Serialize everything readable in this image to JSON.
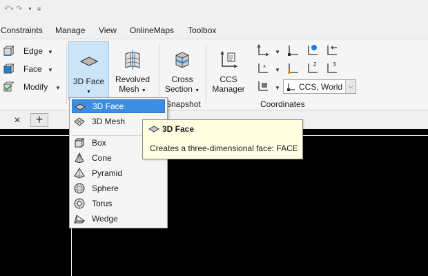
{
  "menu": [
    "Constraints",
    "Manage",
    "View",
    "OnlineMaps",
    "Toolbox"
  ],
  "ribbon": {
    "small_buttons": [
      "Edge",
      "Face",
      "Modify"
    ],
    "face3d_label": "3D Face",
    "revolved_mesh_label": [
      "Revolved",
      "Mesh"
    ],
    "cross_section_label": [
      "Cross",
      "Section"
    ],
    "ccs_manager_label": [
      "CCS",
      "Manager"
    ],
    "coordinates_combo": "CCS, World",
    "group_snapshot": "Snapshot",
    "group_coordinates": "Coordinates",
    "coord_digits": [
      "2",
      "3"
    ]
  },
  "tabs": {
    "close_glyph": "×",
    "add_glyph": "+"
  },
  "dropdown": {
    "items": [
      "3D Face",
      "3D Mesh",
      "Box",
      "Cone",
      "Pyramid",
      "Sphere",
      "Torus",
      "Wedge"
    ],
    "selected": "3D Face"
  },
  "tooltip": {
    "title": "3D Face",
    "description": "Creates a three-dimensional face:  FACE"
  },
  "colors": {
    "accent": "#3d8ee0",
    "canvas_bg": "#000000",
    "tooltip_bg": "#ffffe1",
    "highlight": "#cce4f7"
  }
}
